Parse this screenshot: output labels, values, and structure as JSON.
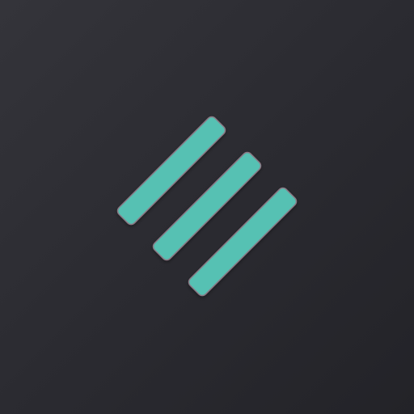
{
  "icon": {
    "name": "three-diagonal-bars-logo",
    "background_color": "#2e2e34",
    "bar_color": "#56c1b3",
    "bar_edge_color": "#8a7a86",
    "bar_count": 3
  }
}
